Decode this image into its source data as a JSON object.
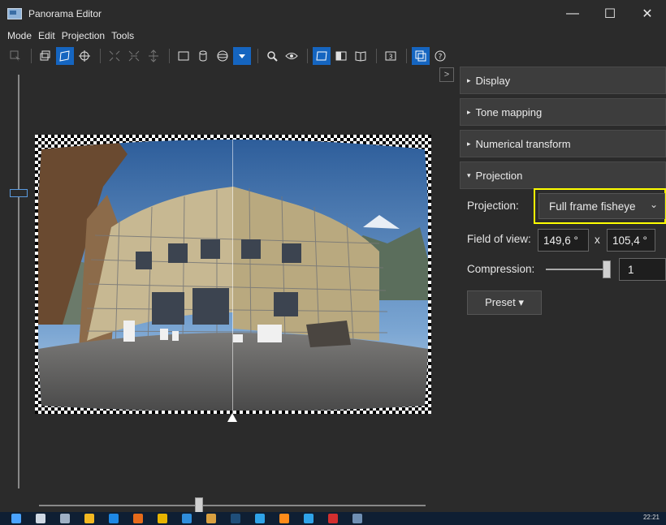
{
  "window": {
    "title": "Panorama Editor",
    "buttons": {
      "minimize": "—",
      "maximize": "☐",
      "close": "✕"
    }
  },
  "menu": [
    "Mode",
    "Edit",
    "Projection",
    "Tools"
  ],
  "toolbar": {
    "icons": [
      "select-mode-icon",
      "preview-mode-icon",
      "layout-mode-icon",
      "crosshair-icon",
      "fit-icon",
      "compress-icon",
      "center-icon",
      "rectilinear-icon",
      "cylinder-icon",
      "sphere-icon",
      "dropdown-icon",
      "zoom-icon",
      "eye-icon",
      "view-rect-icon",
      "view-half-icon",
      "view-book-icon",
      "3d-icon",
      "panel-icon",
      "help-icon"
    ]
  },
  "panel": {
    "collapse_label": ">",
    "sections": [
      {
        "label": "Display",
        "expanded": false
      },
      {
        "label": "Tone mapping",
        "expanded": false
      },
      {
        "label": "Numerical transform",
        "expanded": false
      },
      {
        "label": "Projection",
        "expanded": true
      }
    ],
    "projection_label": "Projection:",
    "projection_value": "Full frame fisheye",
    "fov_label": "Field of view:",
    "fov_h": "149,6 °",
    "fov_x": "x",
    "fov_v": "105,4 °",
    "compression_label": "Compression:",
    "compression_value": "1",
    "preset_label": "Preset ▾"
  },
  "taskbar": {
    "clock": "22:21"
  },
  "colors": {
    "accent": "#1565c0",
    "highlight": "#ffff00",
    "background": "#2b2b2b"
  }
}
